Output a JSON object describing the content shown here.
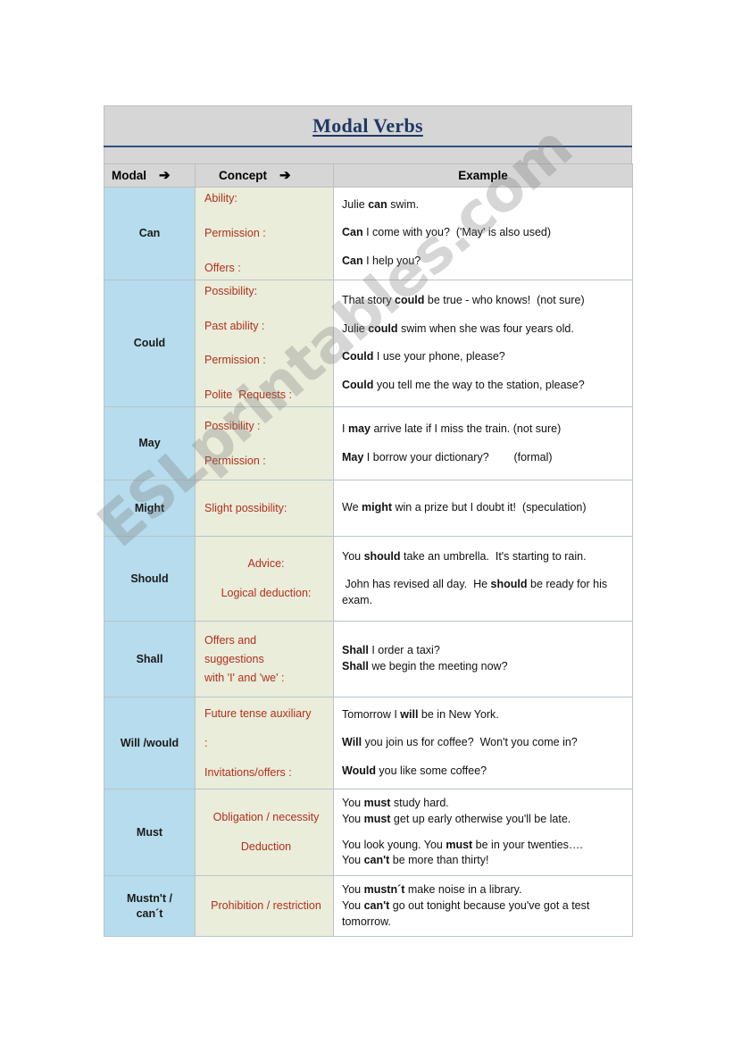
{
  "document": {
    "title": "Modal Verbs",
    "watermark": "ESLprintables.com"
  },
  "colors": {
    "title_text": "#1f3864",
    "title_band": "#d6d6d6",
    "modal_column": "#b6dced",
    "concept_column": "#e9edda",
    "concept_text": "#b3301f",
    "example_background": "#ffffff",
    "border": "#b9c4c9"
  },
  "table": {
    "headers": {
      "modal": "Modal",
      "modal_arrow": "➔",
      "concept": "Concept",
      "concept_arrow": "➔",
      "example": "Example"
    },
    "rows": [
      {
        "modal": "Can",
        "concepts": [
          "Ability:",
          "Permission :",
          "Offers :"
        ],
        "examples": [
          [
            {
              "t": "Julie ",
              "b": false
            },
            {
              "t": "can",
              "b": true
            },
            {
              "t": " swim.",
              "b": false
            }
          ],
          [
            {
              "t": "Can",
              "b": true
            },
            {
              "t": " I come with you?  ('May' is also used)",
              "b": false
            }
          ],
          [
            {
              "t": "Can",
              "b": true
            },
            {
              "t": " I help you?",
              "b": false
            }
          ]
        ]
      },
      {
        "modal": "Could",
        "concepts": [
          "Possibility:",
          "Past ability :",
          "Permission :",
          "Polite  Requests :"
        ],
        "examples": [
          [
            {
              "t": "That story ",
              "b": false
            },
            {
              "t": "could",
              "b": true
            },
            {
              "t": " be true - who knows!  (not sure)",
              "b": false
            }
          ],
          [
            {
              "t": "Julie ",
              "b": false
            },
            {
              "t": "could",
              "b": true
            },
            {
              "t": " swim when she was four years old.",
              "b": false
            }
          ],
          [
            {
              "t": "Could",
              "b": true
            },
            {
              "t": " I use your phone, please?",
              "b": false
            }
          ],
          [
            {
              "t": "Could",
              "b": true
            },
            {
              "t": " you tell me the way to the station, please?",
              "b": false
            }
          ]
        ]
      },
      {
        "modal": "May",
        "concepts": [
          "Possibility :",
          "Permission :"
        ],
        "examples": [
          [
            {
              "t": "I ",
              "b": false
            },
            {
              "t": "may",
              "b": true
            },
            {
              "t": " arrive late if I miss the train. (not sure)",
              "b": false
            }
          ],
          [
            {
              "t": "May",
              "b": true
            },
            {
              "t": " I borrow your dictionary?        (formal)",
              "b": false
            }
          ]
        ]
      },
      {
        "modal": "Might",
        "concepts": [
          "Slight possibility:"
        ],
        "examples": [
          [
            {
              "t": "We ",
              "b": false
            },
            {
              "t": "might",
              "b": true
            },
            {
              "t": " win a prize but I doubt it!  (speculation)",
              "b": false
            }
          ]
        ]
      },
      {
        "modal": "Should",
        "concepts": [
          "Advice:",
          "Logical deduction:"
        ],
        "examples": [
          [
            {
              "t": "You ",
              "b": false
            },
            {
              "t": "should",
              "b": true
            },
            {
              "t": " take an umbrella.  It's starting to rain.",
              "b": false
            }
          ],
          [
            {
              "t": " John has revised all day.  He ",
              "b": false
            },
            {
              "t": "should",
              "b": true
            },
            {
              "t": " be ready for his exam.",
              "b": false
            }
          ]
        ]
      },
      {
        "modal": "Shall",
        "concepts": [
          "Offers and",
          "suggestions",
          "with 'I' and 'we' :"
        ],
        "examples": [
          [
            {
              "t": "Shall",
              "b": true
            },
            {
              "t": " I order a taxi?",
              "b": false
            }
          ],
          [
            {
              "t": "Shall",
              "b": true
            },
            {
              "t": " we begin the meeting now?",
              "b": false
            }
          ]
        ]
      },
      {
        "modal": "Will /would",
        "concepts": [
          "Future tense auxiliary",
          ":",
          "Invitations/offers :"
        ],
        "examples": [
          [
            {
              "t": "Tomorrow I ",
              "b": false
            },
            {
              "t": "will",
              "b": true
            },
            {
              "t": " be in New York.",
              "b": false
            }
          ],
          [
            {
              "t": "Will",
              "b": true
            },
            {
              "t": " you join us for coffee?  Won't you come in?",
              "b": false
            }
          ],
          [
            {
              "t": "Would",
              "b": true
            },
            {
              "t": " you like some coffee?",
              "b": false
            }
          ]
        ]
      },
      {
        "modal": "Must",
        "concepts": [
          "Obligation / necessity",
          "Deduction"
        ],
        "examples": [
          [
            {
              "t": "You ",
              "b": false
            },
            {
              "t": "must",
              "b": true
            },
            {
              "t": " study hard.",
              "b": false
            }
          ],
          [
            {
              "t": "You ",
              "b": false
            },
            {
              "t": "must",
              "b": true
            },
            {
              "t": " get up early otherwise you'll be late.",
              "b": false
            }
          ],
          [
            {
              "t": "",
              "b": false
            }
          ],
          [
            {
              "t": "You look young. You ",
              "b": false
            },
            {
              "t": "must",
              "b": true
            },
            {
              "t": " be in your twenties….",
              "b": false
            }
          ],
          [
            {
              "t": "You ",
              "b": false
            },
            {
              "t": "can't",
              "b": true
            },
            {
              "t": " be more than thirty!",
              "b": false
            }
          ]
        ]
      },
      {
        "modal": "Mustn't /\ncan´t",
        "concepts": [
          "Prohibition / restriction"
        ],
        "examples": [
          [
            {
              "t": "You ",
              "b": false
            },
            {
              "t": "mustn´t",
              "b": true
            },
            {
              "t": " make noise in a library.",
              "b": false
            }
          ],
          [
            {
              "t": "You ",
              "b": false
            },
            {
              "t": "can't",
              "b": true
            },
            {
              "t": " go out tonight because you've got a test tomorrow.",
              "b": false
            }
          ]
        ]
      }
    ]
  }
}
